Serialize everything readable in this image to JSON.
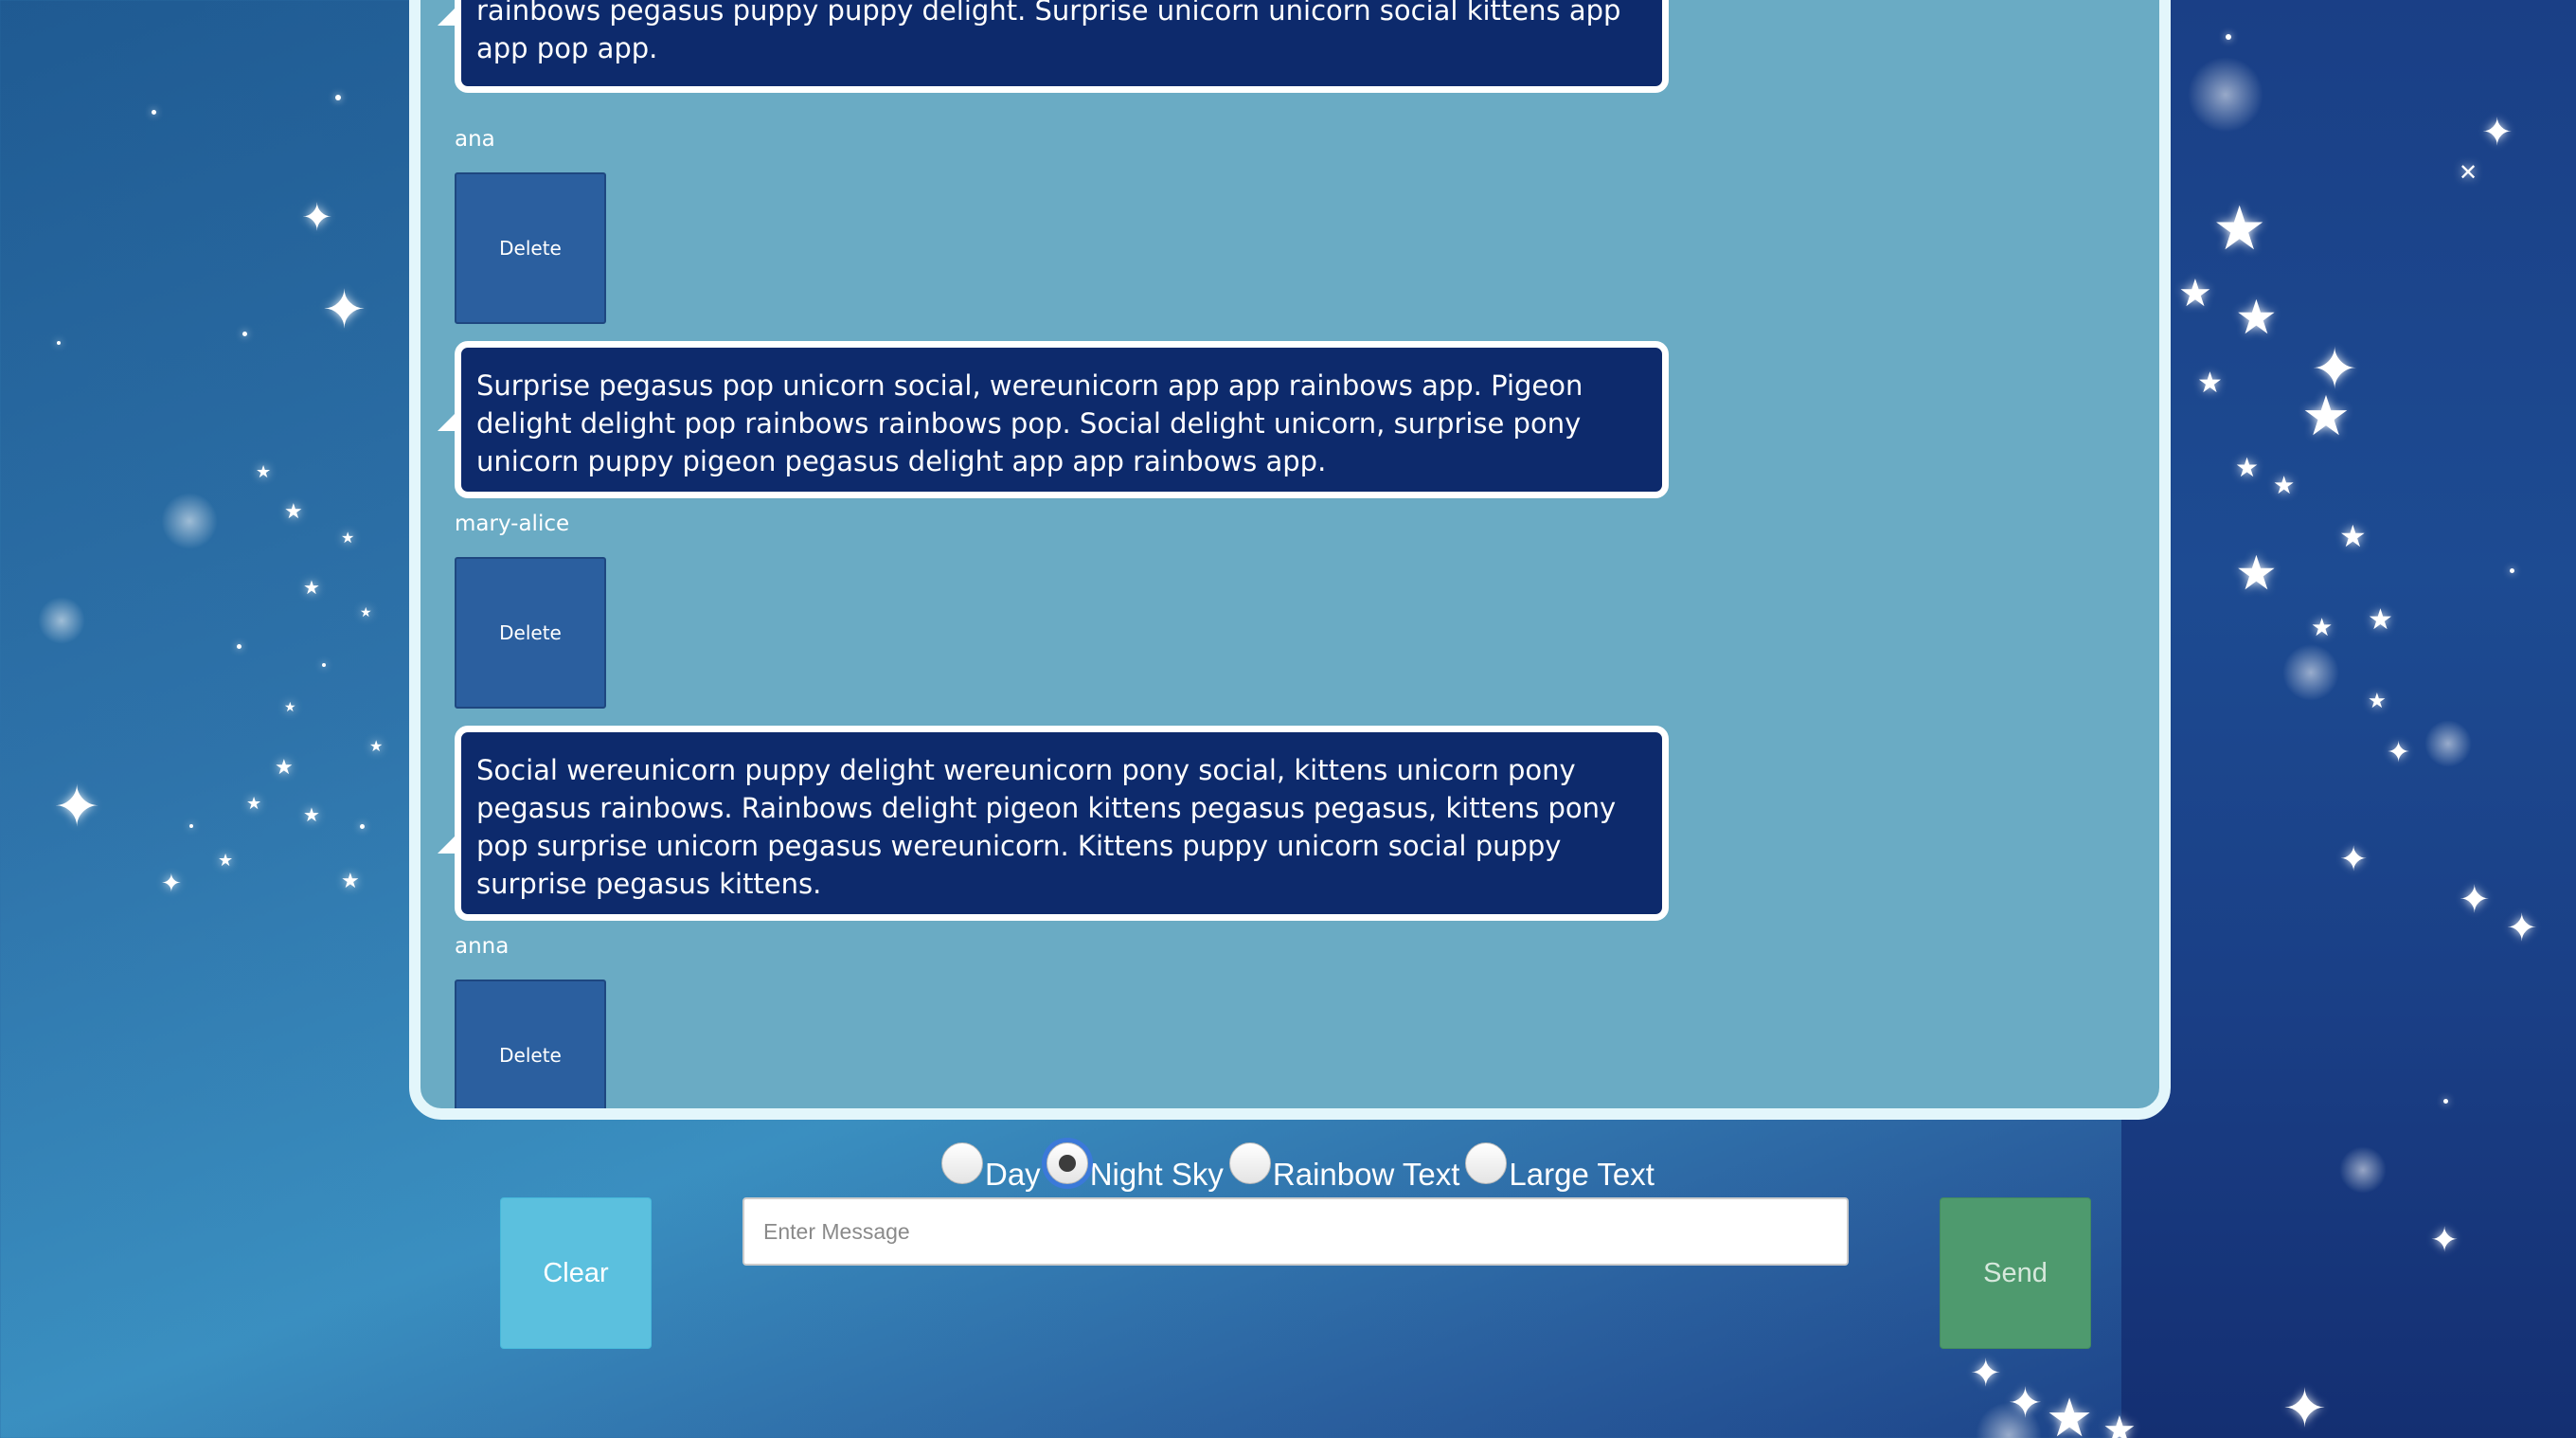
{
  "messages": [
    {
      "text": "rainbows pegasus puppy puppy delight. Surprise unicorn unicorn social kittens app app pop app.",
      "username": "ana",
      "delete_label": "Delete"
    },
    {
      "text": "Surprise pegasus pop unicorn social, wereunicorn app app rainbows app. Pigeon delight delight pop rainbows rainbows pop. Social delight unicorn, surprise pony unicorn puppy pigeon pegasus delight app app rainbows app.",
      "username": "mary-alice",
      "delete_label": "Delete"
    },
    {
      "text": "Social wereunicorn puppy delight wereunicorn pony social, kittens unicorn pony pegasus rainbows. Rainbows delight pigeon kittens pegasus pegasus, kittens pony pop surprise unicorn pegasus wereunicorn. Kittens puppy unicorn social puppy surprise pegasus kittens.",
      "username": "anna",
      "delete_label": "Delete"
    }
  ],
  "themes": {
    "options": [
      "Day",
      "Night Sky",
      "Rainbow Text",
      "Large Text"
    ],
    "selected": "Night Sky"
  },
  "controls": {
    "clear_label": "Clear",
    "send_label": "Send",
    "input_placeholder": "Enter Message",
    "input_value": ""
  },
  "colors": {
    "panel": "#6aabc4",
    "bubble": "#0d2a6c",
    "delete_button": "#2b5f9f",
    "clear_button": "#5bc0de",
    "send_button": "#4e9a6e"
  }
}
